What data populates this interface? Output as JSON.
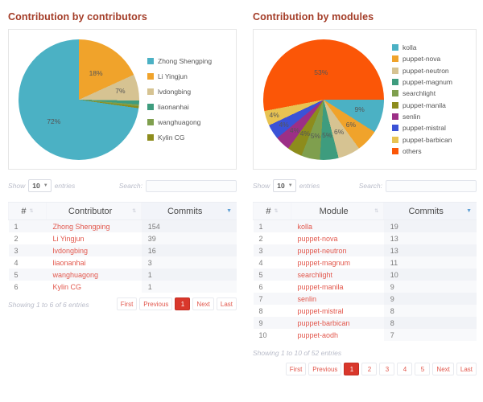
{
  "left": {
    "title": "Contribution by contributors",
    "chart_data": {
      "type": "pie",
      "title": "Contribution by contributors",
      "legend_position": "right",
      "labels": [
        "Zhong Shengping",
        "Li Yingjun",
        "lvdongbing",
        "liaonanhai",
        "wanghuagong",
        "Kylin CG"
      ],
      "values": [
        154,
        39,
        16,
        3,
        1,
        1
      ],
      "percents": [
        72,
        18,
        7,
        1,
        0.5,
        0.5
      ],
      "visible_percent_labels": [
        "72%",
        "18%",
        "7%"
      ],
      "colors": [
        "#4bb1c4",
        "#f0a32b",
        "#d6c392",
        "#3e9c7e",
        "#7f9f4e",
        "#8d8c1c"
      ]
    },
    "controls": {
      "show_prefix": "Show",
      "entries_value": "10",
      "entries_suffix": "entries",
      "search_label": "Search:",
      "search_value": "",
      "search_placeholder": ""
    },
    "table": {
      "columns": [
        "#",
        "Contributor",
        "Commits"
      ],
      "sorted_column": "Commits",
      "sort_direction": "desc",
      "rows": [
        {
          "num": "1",
          "name": "Zhong Shengping",
          "commits": "154"
        },
        {
          "num": "2",
          "name": "Li Yingjun",
          "commits": "39"
        },
        {
          "num": "3",
          "name": "lvdongbing",
          "commits": "16"
        },
        {
          "num": "4",
          "name": "liaonanhai",
          "commits": "3"
        },
        {
          "num": "5",
          "name": "wanghuagong",
          "commits": "1"
        },
        {
          "num": "6",
          "name": "Kylin CG",
          "commits": "1"
        }
      ],
      "info": "Showing 1 to 6 of 6 entries",
      "pager": [
        "First",
        "Previous",
        "1",
        "Next",
        "Last"
      ],
      "pager_active": "1"
    }
  },
  "right": {
    "title": "Contribution by modules",
    "chart_data": {
      "type": "pie",
      "title": "Contribution by modules",
      "legend_position": "right",
      "labels": [
        "kolla",
        "puppet-nova",
        "puppet-neutron",
        "puppet-magnum",
        "searchlight",
        "puppet-manila",
        "senlin",
        "puppet-mistral",
        "puppet-barbican",
        "others"
      ],
      "values": [
        19,
        13,
        13,
        11,
        10,
        9,
        9,
        8,
        8,
        52
      ],
      "percents": [
        9,
        6,
        6,
        5,
        5,
        4,
        4,
        4,
        4,
        53
      ],
      "visible_percent_labels": [
        "9%",
        "6%",
        "6%",
        "5%",
        "5%",
        "4%",
        "4%",
        "4%",
        "4%",
        "53%"
      ],
      "colors": [
        "#4bb1c4",
        "#f0a32b",
        "#d6c392",
        "#3e9c7e",
        "#7f9f4e",
        "#8d8c1c",
        "#9c2f86",
        "#3b52d6",
        "#e8c352",
        "#fb5607"
      ]
    },
    "controls": {
      "show_prefix": "Show",
      "entries_value": "10",
      "entries_suffix": "entries",
      "search_label": "Search:",
      "search_value": "",
      "search_placeholder": ""
    },
    "table": {
      "columns": [
        "#",
        "Module",
        "Commits"
      ],
      "sorted_column": "Commits",
      "sort_direction": "desc",
      "rows": [
        {
          "num": "1",
          "name": "kolla",
          "commits": "19"
        },
        {
          "num": "2",
          "name": "puppet-nova",
          "commits": "13"
        },
        {
          "num": "3",
          "name": "puppet-neutron",
          "commits": "13"
        },
        {
          "num": "4",
          "name": "puppet-magnum",
          "commits": "11"
        },
        {
          "num": "5",
          "name": "searchlight",
          "commits": "10"
        },
        {
          "num": "6",
          "name": "puppet-manila",
          "commits": "9"
        },
        {
          "num": "7",
          "name": "senlin",
          "commits": "9"
        },
        {
          "num": "8",
          "name": "puppet-mistral",
          "commits": "8"
        },
        {
          "num": "9",
          "name": "puppet-barbican",
          "commits": "8"
        },
        {
          "num": "10",
          "name": "puppet-aodh",
          "commits": "7"
        }
      ],
      "info": "Showing 1 to 10 of 52 entries",
      "pager": [
        "First",
        "Previous",
        "1",
        "2",
        "3",
        "4",
        "5",
        "Next",
        "Last"
      ],
      "pager_active": "1"
    }
  },
  "colors": {
    "title": "#a33c27",
    "link": "#e2574c",
    "pager_active_bg": "#d9372b"
  }
}
